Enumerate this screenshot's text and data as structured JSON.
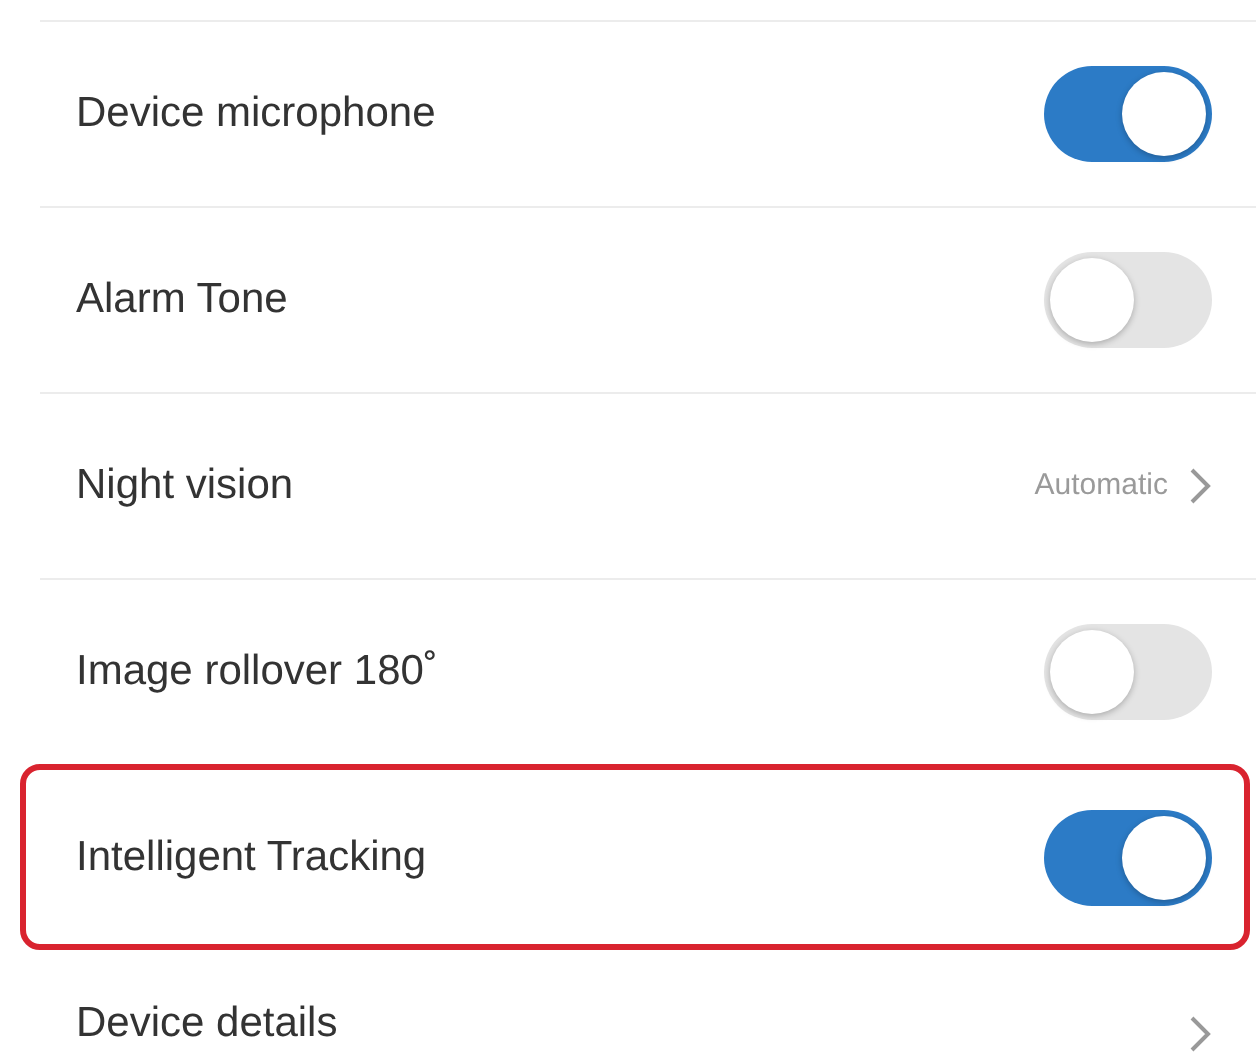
{
  "settings": [
    {
      "kind": "toggle",
      "label": "Device microphone",
      "on": true,
      "highlighted": false
    },
    {
      "kind": "toggle",
      "label": "Alarm Tone",
      "on": false,
      "highlighted": false
    },
    {
      "kind": "value",
      "label": "Night vision",
      "value": "Automatic",
      "highlighted": false
    },
    {
      "kind": "toggle",
      "label": "Image rollover 180˚",
      "on": false,
      "highlighted": false
    },
    {
      "kind": "toggle",
      "label": "Intelligent Tracking",
      "on": true,
      "highlighted": true
    },
    {
      "kind": "link",
      "label": "Device details",
      "highlighted": false
    }
  ]
}
